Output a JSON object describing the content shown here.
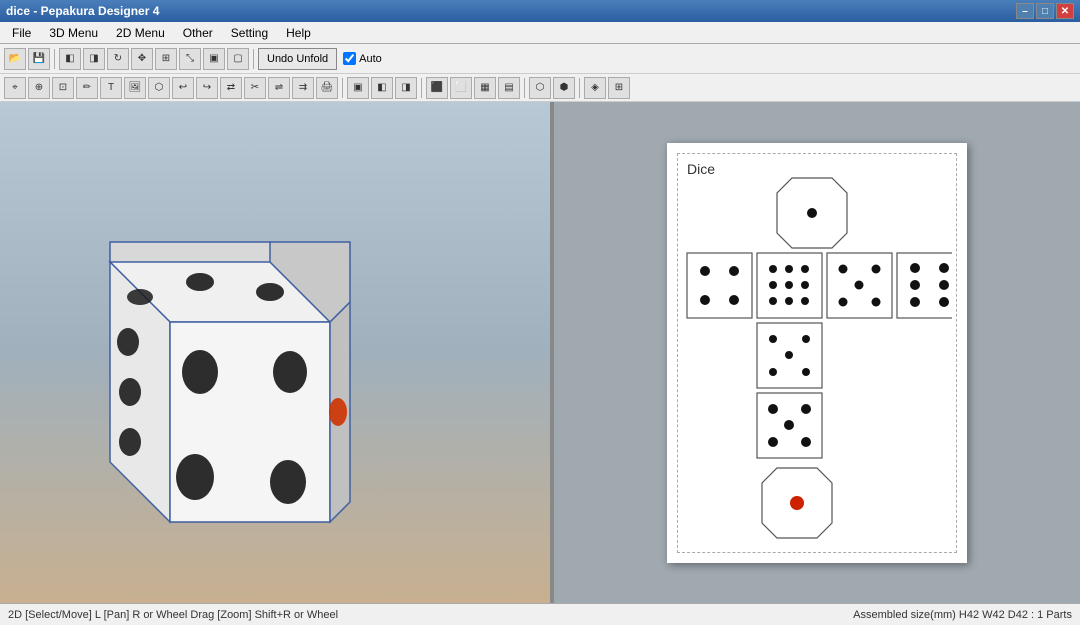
{
  "titlebar": {
    "title": "dice - Pepakura Designer 4",
    "min_label": "–",
    "max_label": "□",
    "close_label": "✕"
  },
  "menubar": {
    "items": [
      "File",
      "3D Menu",
      "2D Menu",
      "Other",
      "Setting",
      "Help"
    ]
  },
  "toolbar1": {
    "undo_unfold_label": "Undo Unfold",
    "auto_label": "Auto"
  },
  "statusbar": {
    "left_text": "2D [Select/Move] L [Pan] R or Wheel Drag [Zoom] Shift+R or Wheel",
    "right_text": "Assembled size(mm) H42 W42 D42 : 1 Parts"
  },
  "view2d": {
    "dice_label": "Dice"
  }
}
